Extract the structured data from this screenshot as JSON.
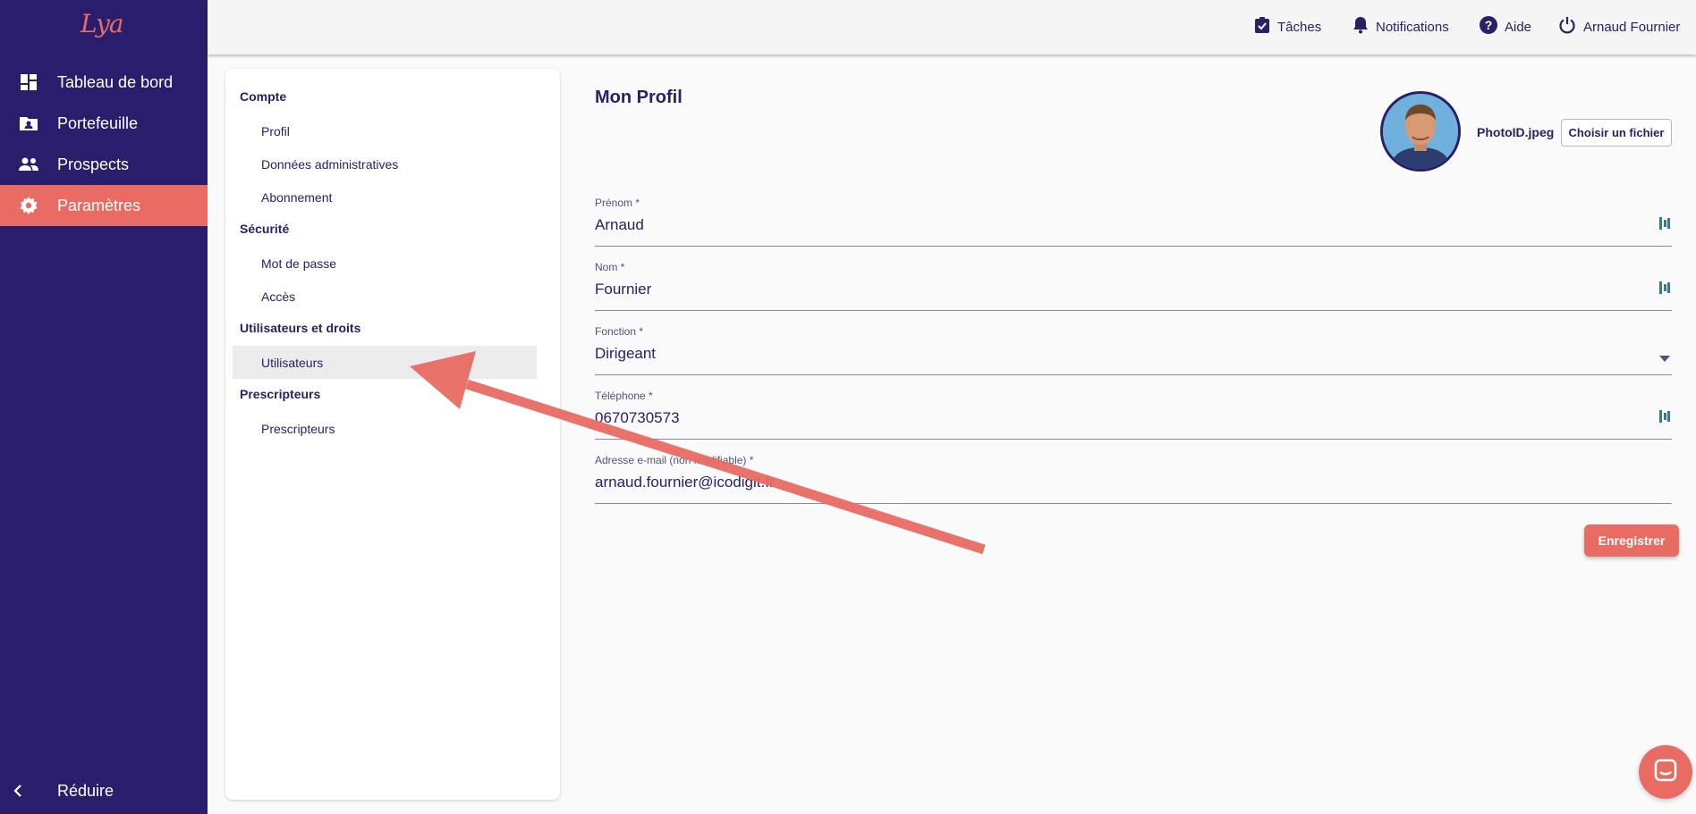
{
  "app": {
    "logo": "Lya"
  },
  "sidebar": {
    "items": [
      {
        "label": "Tableau de bord",
        "icon": "dashboard-icon"
      },
      {
        "label": "Portefeuille",
        "icon": "folder-user-icon"
      },
      {
        "label": "Prospects",
        "icon": "people-icon"
      },
      {
        "label": "Paramètres",
        "icon": "gear-icon",
        "active": true
      }
    ],
    "collapse_label": "Réduire"
  },
  "topbar": {
    "tasks": "Tâches",
    "notifications": "Notifications",
    "help": "Aide",
    "user": "Arnaud Fournier"
  },
  "menu": {
    "sections": [
      {
        "title": "Compte",
        "links": [
          "Profil",
          "Données administratives",
          "Abonnement"
        ]
      },
      {
        "title": "Sécurité",
        "links": [
          "Mot de passe",
          "Accès"
        ]
      },
      {
        "title": "Utilisateurs et droits",
        "links": [
          "Utilisateurs"
        ]
      },
      {
        "title": "Prescripteurs",
        "links": [
          "Prescripteurs"
        ]
      }
    ],
    "selected": "Utilisateurs"
  },
  "profile": {
    "title": "Mon Profil",
    "photo_file": "PhotoID.jpeg",
    "choose_file": "Choisir un fichier",
    "fields": [
      {
        "label": "Prénom *",
        "value": "Arnaud"
      },
      {
        "label": "Nom *",
        "value": "Fournier"
      },
      {
        "label": "Fonction *",
        "value": "Dirigeant"
      },
      {
        "label": "Téléphone *",
        "value": "0670730573"
      },
      {
        "label": "Adresse e-mail (non modifiable) *",
        "value": "arnaud.fournier@icodigit.fr"
      }
    ],
    "save": "Enregistrer"
  },
  "colors": {
    "sidebar": "#2a1d6b",
    "accent": "#e86c63",
    "text": "#2a2068"
  }
}
